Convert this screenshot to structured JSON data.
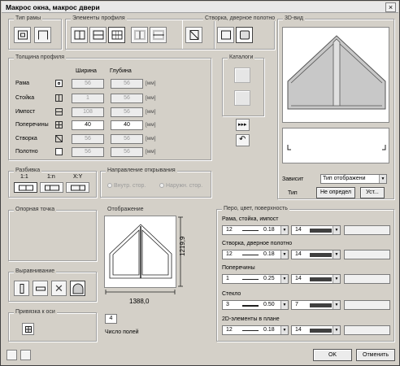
{
  "window": {
    "title": "Макрос окна, макрос двери",
    "close": "×"
  },
  "frame_type": {
    "legend": "Тип рамы"
  },
  "profile_elements": {
    "legend": "Элементы профиля"
  },
  "sash": {
    "legend": "Створка, дверное полотно"
  },
  "view3d": {
    "legend": "3D-вид"
  },
  "thickness": {
    "legend": "Толщина профиля",
    "col_width": "Ширина",
    "col_depth": "Глубина",
    "rows": [
      {
        "label": "Рама",
        "width": "56",
        "depth": "56",
        "unit": "[мм]",
        "enabled": false
      },
      {
        "label": "Стойка",
        "width": "1",
        "depth": "56",
        "unit": "[мм]",
        "enabled": false
      },
      {
        "label": "Импост",
        "width": "108",
        "depth": "56",
        "unit": "[мм]",
        "enabled": false
      },
      {
        "label": "Поперечины",
        "width": "40",
        "depth": "40",
        "unit": "[мм]",
        "enabled": true
      },
      {
        "label": "Створка",
        "width": "56",
        "depth": "56",
        "unit": "[мм]",
        "enabled": false
      },
      {
        "label": "Полотно",
        "width": "56",
        "depth": "56",
        "unit": "[мм]",
        "enabled": false
      }
    ]
  },
  "catalogs": {
    "legend": "Каталоги"
  },
  "depends": {
    "label": "Зависит",
    "value": "Тип отображени"
  },
  "type": {
    "label": "Тип",
    "btn_undefined": "Не определ",
    "btn_set": "Уст..."
  },
  "split": {
    "legend": "Разбивка",
    "opt1": "1:1",
    "opt2": "1:n",
    "opt3": "X:Y"
  },
  "opening": {
    "legend": "Направление открывания",
    "inner": "Внутр. стор.",
    "outer": "Наружн. стор."
  },
  "anchor": {
    "legend": "Опорная точка"
  },
  "display": {
    "legend": "Отображение",
    "width_dim": "1388,0",
    "height_dim": "1219,9",
    "fields_count": "4",
    "fields_label": "Число полей"
  },
  "align": {
    "legend": "Выравнивание"
  },
  "axis": {
    "legend": "Привязка к оси"
  },
  "pen": {
    "legend": "Перо, цвет, поверхность",
    "rows": [
      {
        "label": "Рама, стойка, импост",
        "pen": "12",
        "thick": "0.18",
        "color": "14"
      },
      {
        "label": "Створка, дверное полотно",
        "pen": "12",
        "thick": "0.18",
        "color": "14"
      },
      {
        "label": "Поперечины",
        "pen": "1",
        "thick": "0.25",
        "color": "14"
      },
      {
        "label": "Стекло",
        "pen": "3",
        "thick": "0.50",
        "color": "7"
      },
      {
        "label": "2D-элементы в плане",
        "pen": "12",
        "thick": "0.18",
        "color": "14"
      }
    ]
  },
  "footer": {
    "ok": "OK",
    "cancel": "Отменить"
  },
  "colors": {
    "dialog_bg": "#d4d0c8",
    "glass": "#c8c8c8"
  },
  "icons": {
    "arrow_right": "▸▸▸",
    "undo": "↶"
  }
}
